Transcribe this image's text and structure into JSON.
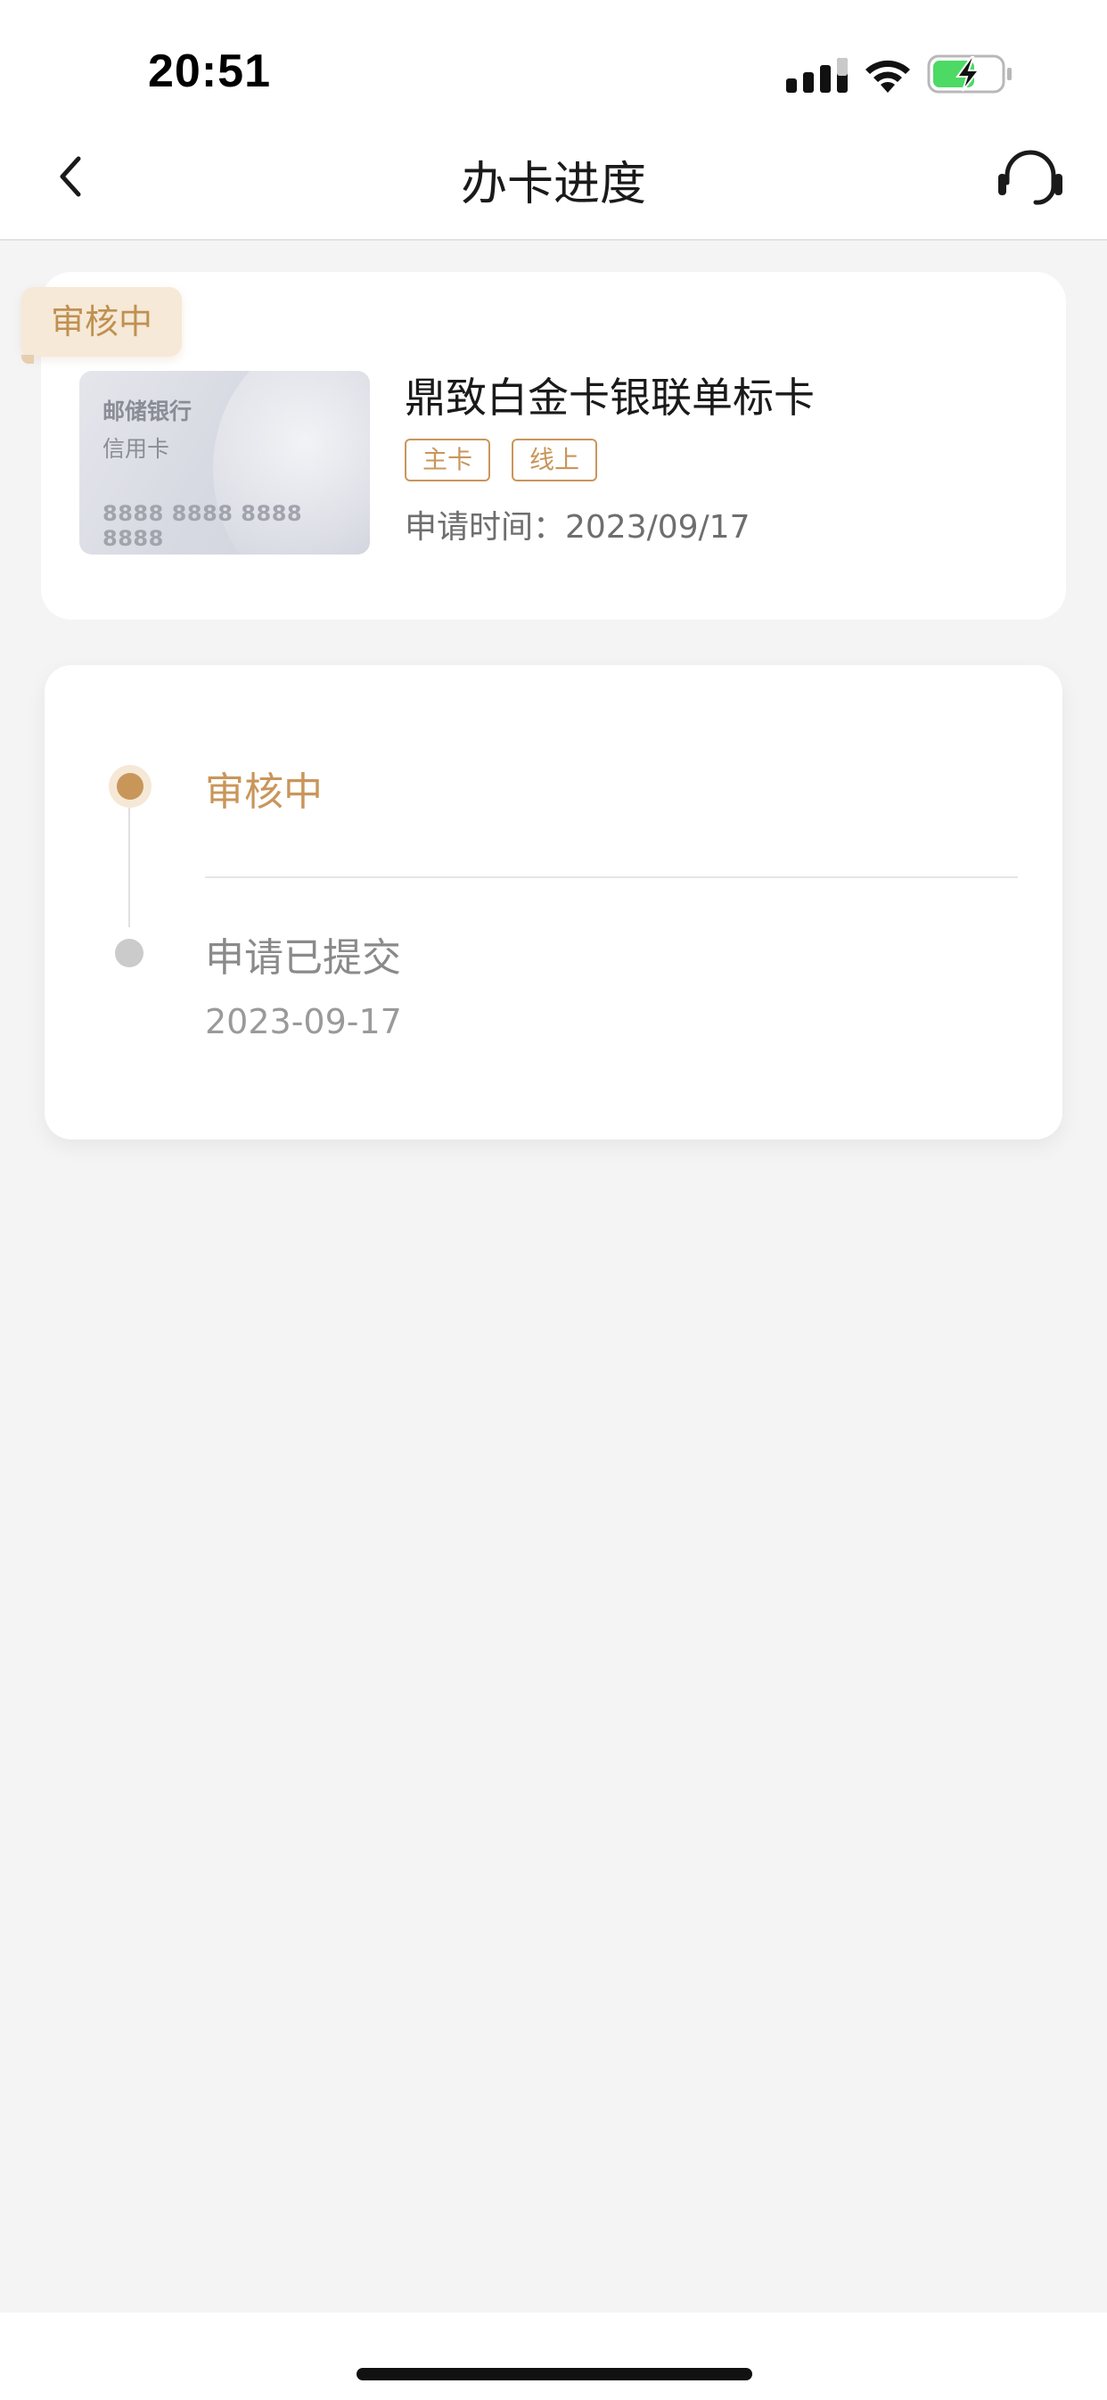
{
  "status_bar": {
    "time": "20:51",
    "icons": [
      "cellular-signal-icon",
      "wifi-icon",
      "battery-charging-icon"
    ],
    "battery_color": "#4cd964"
  },
  "nav": {
    "title": "办卡进度",
    "back_icon": "chevron-left-icon",
    "service_icon": "headset-icon"
  },
  "application": {
    "status_badge": "审核中",
    "card_image": {
      "bank": "邮储银行",
      "type": "信用卡",
      "number": "8888 8888 8888 8888"
    },
    "card_name": "鼎致白金卡银联单标卡",
    "tags": [
      "主卡",
      "线上"
    ],
    "apply_time": "申请时间：2023/09/17"
  },
  "timeline": {
    "steps": [
      {
        "label": "审核中",
        "state": "current"
      },
      {
        "label": "申请已提交",
        "date": "2023-09-17",
        "state": "done"
      }
    ]
  },
  "colors": {
    "accent": "#c9965a",
    "badge_bg": "#f6e9d7",
    "page_bg": "#f4f4f5"
  }
}
